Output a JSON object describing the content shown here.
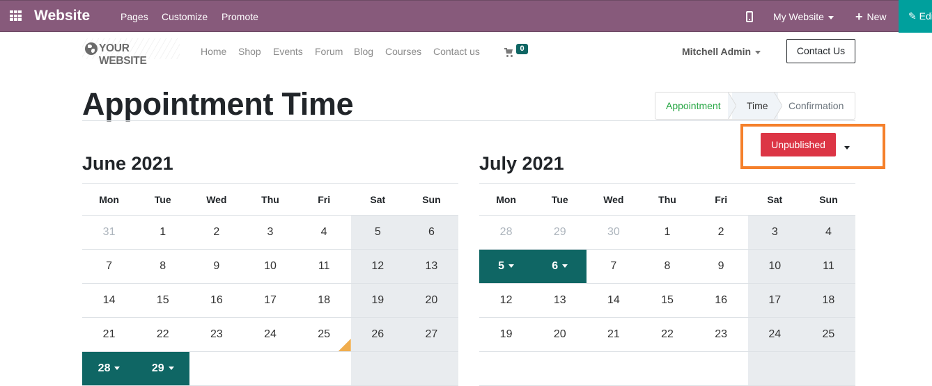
{
  "topbar": {
    "app_name": "Website",
    "menu": [
      "Pages",
      "Customize",
      "Promote"
    ],
    "website_selector": "My Website",
    "new_label": "New",
    "edit_label": "Edit",
    "colors": {
      "bar": "#875a7b",
      "edit": "#00a09d"
    }
  },
  "site_nav": {
    "logo_text": "YOUR WEBSITE",
    "links": [
      "Home",
      "Shop",
      "Events",
      "Forum",
      "Blog",
      "Courses",
      "Contact us"
    ],
    "cart_count": "0",
    "user": "Mitchell Admin",
    "contact_button": "Contact Us"
  },
  "page": {
    "title": "Appointment Time",
    "steps": [
      {
        "label": "Appointment",
        "state": "done"
      },
      {
        "label": "Time",
        "state": "active"
      },
      {
        "label": "Confirmation",
        "state": "pending"
      }
    ],
    "publish_status": "Unpublished",
    "colors": {
      "available": "#0f6664",
      "unpublished": "#dc3545",
      "highlight": "#f5802b",
      "today": "#f0ad4e"
    }
  },
  "weekdays": [
    "Mon",
    "Tue",
    "Wed",
    "Thu",
    "Fri",
    "Sat",
    "Sun"
  ],
  "calendars": [
    {
      "month": "June 2021",
      "weeks": [
        [
          {
            "d": "31",
            "m": 1
          },
          {
            "d": "1"
          },
          {
            "d": "2"
          },
          {
            "d": "3"
          },
          {
            "d": "4"
          },
          {
            "d": "5"
          },
          {
            "d": "6"
          }
        ],
        [
          {
            "d": "7"
          },
          {
            "d": "8"
          },
          {
            "d": "9"
          },
          {
            "d": "10"
          },
          {
            "d": "11"
          },
          {
            "d": "12"
          },
          {
            "d": "13"
          }
        ],
        [
          {
            "d": "14"
          },
          {
            "d": "15"
          },
          {
            "d": "16"
          },
          {
            "d": "17"
          },
          {
            "d": "18"
          },
          {
            "d": "19"
          },
          {
            "d": "20"
          }
        ],
        [
          {
            "d": "21"
          },
          {
            "d": "22"
          },
          {
            "d": "23"
          },
          {
            "d": "24"
          },
          {
            "d": "25",
            "today": 1
          },
          {
            "d": "26"
          },
          {
            "d": "27"
          }
        ],
        [
          {
            "d": "28",
            "a": 1
          },
          {
            "d": "29",
            "a": 1
          },
          {
            "d": ""
          },
          {
            "d": ""
          },
          {
            "d": ""
          },
          {
            "d": ""
          },
          {
            "d": ""
          }
        ]
      ]
    },
    {
      "month": "July 2021",
      "weeks": [
        [
          {
            "d": "28",
            "m": 1
          },
          {
            "d": "29",
            "m": 1
          },
          {
            "d": "30",
            "m": 1
          },
          {
            "d": "1"
          },
          {
            "d": "2"
          },
          {
            "d": "3"
          },
          {
            "d": "4"
          }
        ],
        [
          {
            "d": "5",
            "a": 1
          },
          {
            "d": "6",
            "a": 1
          },
          {
            "d": "7"
          },
          {
            "d": "8"
          },
          {
            "d": "9"
          },
          {
            "d": "10"
          },
          {
            "d": "11"
          }
        ],
        [
          {
            "d": "12"
          },
          {
            "d": "13"
          },
          {
            "d": "14"
          },
          {
            "d": "15"
          },
          {
            "d": "16"
          },
          {
            "d": "17"
          },
          {
            "d": "18"
          }
        ],
        [
          {
            "d": "19"
          },
          {
            "d": "20"
          },
          {
            "d": "21"
          },
          {
            "d": "22"
          },
          {
            "d": "23"
          },
          {
            "d": "24"
          },
          {
            "d": "25"
          }
        ],
        [
          {
            "d": ""
          },
          {
            "d": ""
          },
          {
            "d": ""
          },
          {
            "d": ""
          },
          {
            "d": ""
          },
          {
            "d": ""
          },
          {
            "d": ""
          }
        ]
      ]
    }
  ]
}
